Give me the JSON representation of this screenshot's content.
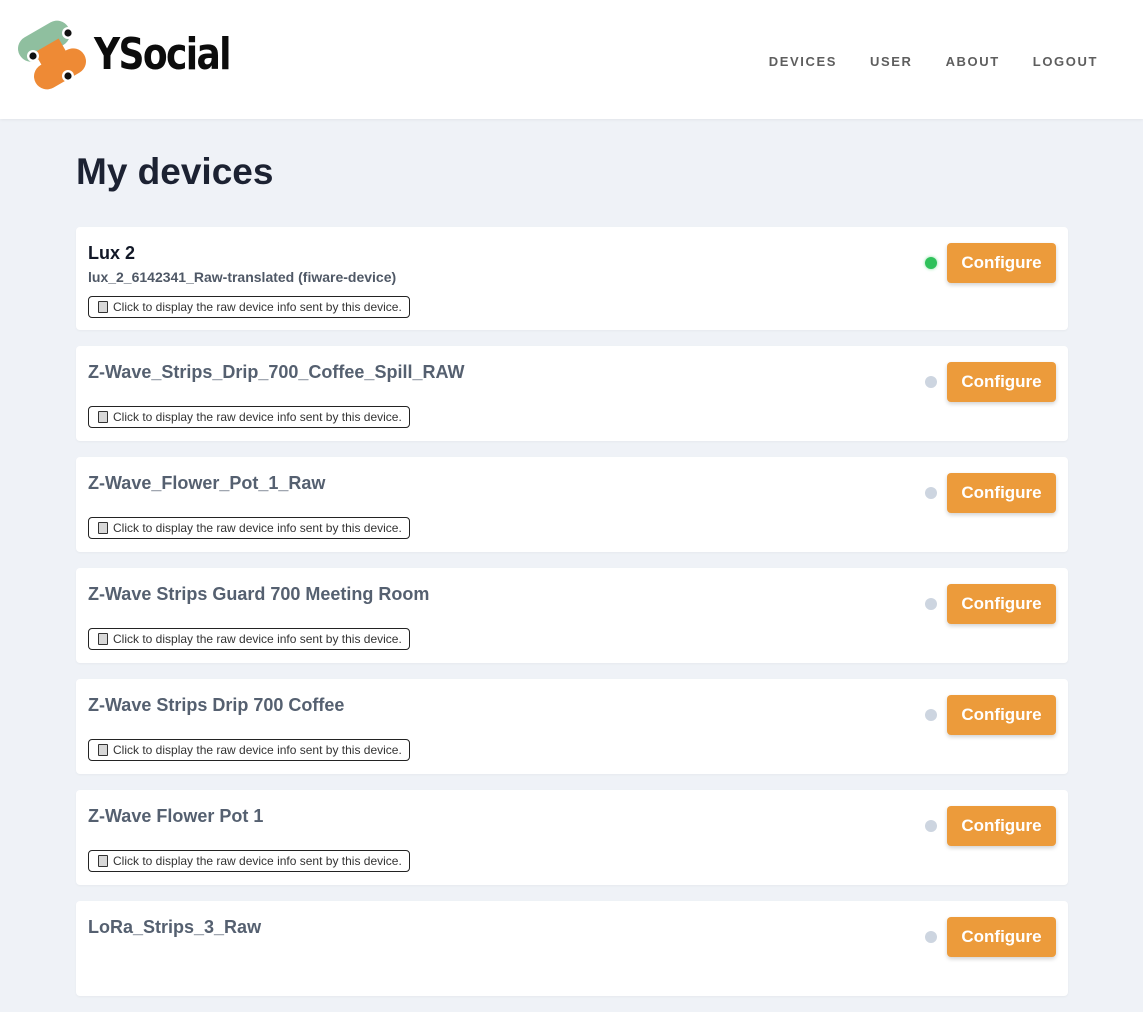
{
  "brand": {
    "name": "YSocial"
  },
  "nav": {
    "items": [
      {
        "label": "DEVICES"
      },
      {
        "label": "USER"
      },
      {
        "label": "ABOUT"
      },
      {
        "label": "LOGOUT"
      }
    ]
  },
  "page": {
    "title": "My devices"
  },
  "colors": {
    "accent": "#ec9b3b",
    "online": "#2fc15b",
    "offline": "#cdd5e0",
    "background": "#eff2f7",
    "logo_green": "#8fbf9f",
    "logo_orange": "#ee8a35"
  },
  "devices": [
    {
      "name": "Lux 2",
      "id": "lux_2_6142341_Raw-translated (fiware-device)",
      "status": "online",
      "raw_label": "Click to display the raw device info sent by this device.",
      "configure_label": "Configure"
    },
    {
      "name": "Z-Wave_Strips_Drip_700_Coffee_Spill_RAW",
      "id": "",
      "status": "offline",
      "raw_label": "Click to display the raw device info sent by this device.",
      "configure_label": "Configure"
    },
    {
      "name": "Z-Wave_Flower_Pot_1_Raw",
      "id": "",
      "status": "offline",
      "raw_label": "Click to display the raw device info sent by this device.",
      "configure_label": "Configure"
    },
    {
      "name": "Z-Wave Strips Guard 700 Meeting Room",
      "id": "",
      "status": "offline",
      "raw_label": "Click to display the raw device info sent by this device.",
      "configure_label": "Configure"
    },
    {
      "name": "Z-Wave Strips Drip 700 Coffee",
      "id": "",
      "status": "offline",
      "raw_label": "Click to display the raw device info sent by this device.",
      "configure_label": "Configure"
    },
    {
      "name": "Z-Wave Flower Pot 1",
      "id": "",
      "status": "offline",
      "raw_label": "Click to display the raw device info sent by this device.",
      "configure_label": "Configure"
    },
    {
      "name": "LoRa_Strips_3_Raw",
      "id": "",
      "status": "offline",
      "raw_label": "",
      "configure_label": "Configure"
    }
  ]
}
